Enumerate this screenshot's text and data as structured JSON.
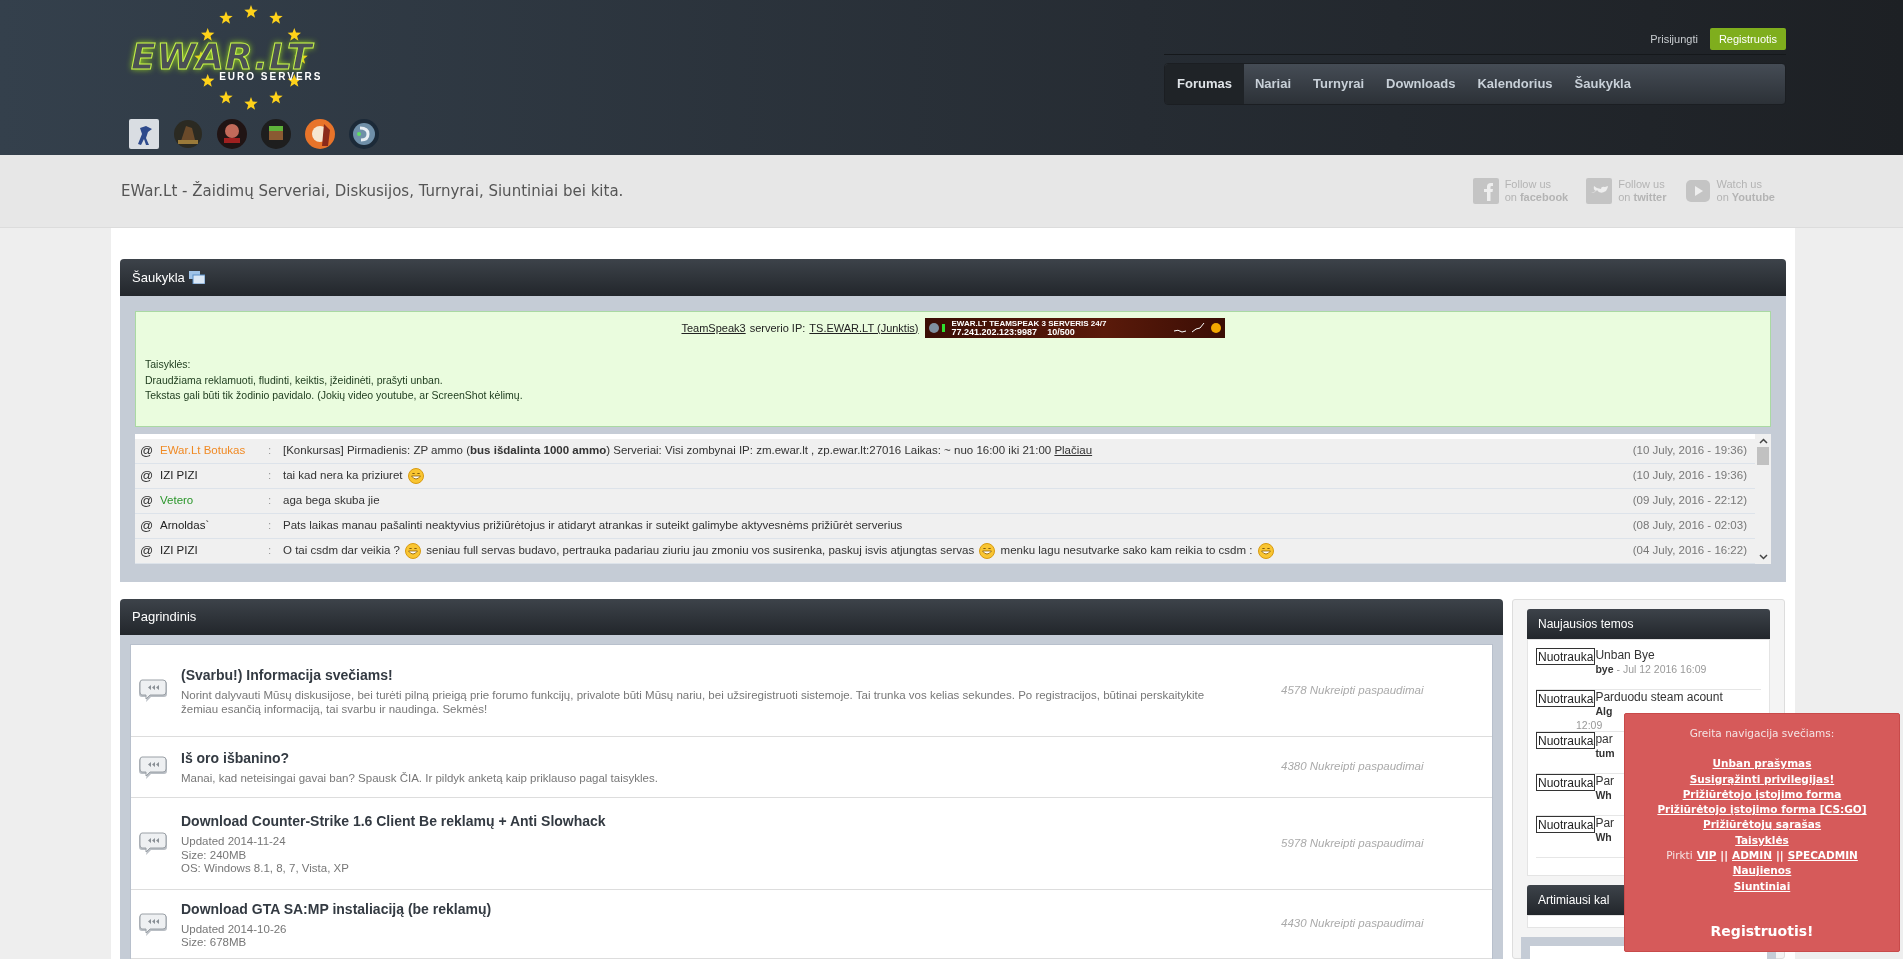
{
  "header": {
    "logo": {
      "title": "EWAR.LT",
      "subtitle": "EURO SERVERS"
    },
    "login_link": "Prisijungti",
    "register_button": "Registruotis",
    "nav": [
      {
        "label": "Forumas",
        "selected": true
      },
      {
        "label": "Nariai",
        "selected": false
      },
      {
        "label": "Turnyrai",
        "selected": false
      },
      {
        "label": "Downloads",
        "selected": false
      },
      {
        "label": "Kalendorius",
        "selected": false
      },
      {
        "label": "Šaukykla",
        "selected": false
      }
    ]
  },
  "tagline": "EWar.Lt - Žaidimų Serveriai, Diskusijos, Turnyrai, Siuntiniai bei kita.",
  "social": [
    {
      "kind": "facebook",
      "line1": "Follow us",
      "line2": "on **facebook**"
    },
    {
      "kind": "twitter",
      "line1": "Follow us",
      "line2": "on **twitter**"
    },
    {
      "kind": "youtube",
      "line1": "Watch us",
      "line2": "on **Youtube**"
    }
  ],
  "shoutbox": {
    "title": "Šaukykla",
    "notice": {
      "ts_link": "TeamSpeak3",
      "ts_text": "serverio IP:",
      "ip_link": "TS.EWAR.LT (Junktis)",
      "banner": {
        "line1": "EWAR.LT TEAMSPEAK 3 SERVERIS 24/7",
        "line2": "77.241.202.123:9987",
        "line3": "10/500"
      },
      "rules": [
        "Taisyklės:",
        "Draudžiama reklamuoti, fludinti, keiktis, įžeidinėti, prašyti unban.",
        "Tekstas gali būti tik žodinio pavidalo. (Jokių video youtube, ar ScreenShot kėlimų."
      ]
    },
    "mention_symbol": "@",
    "separator": ":",
    "messages": [
      {
        "author": "EWar.Lt Botukas",
        "color": "#f08a24",
        "parts": [
          {
            "kind": "text",
            "text": "[Konkursas] Pirmadienis: ZP ammo (**bus išdalinta 1000 ammo**) Serveriai: Visi zombynai IP: zm.ewar.lt , zp.ewar.lt:27016 Laikas: ~ nuo 16:00 iki 21:00"
          },
          {
            "kind": "link",
            "text": "Plačiau"
          }
        ],
        "time": "(10 July, 2016 - 19:36)"
      },
      {
        "author": "IZI PIZI",
        "color": "#222222",
        "parts": [
          {
            "kind": "text",
            "text": "tai kad nera ka priziuret"
          },
          {
            "kind": "smiley"
          }
        ],
        "time": "(10 July, 2016 - 19:36)"
      },
      {
        "author": "Vetero",
        "color": "#2a962a",
        "parts": [
          {
            "kind": "text",
            "text": "aga bega skuba jie"
          }
        ],
        "time": "(09 July, 2016 - 22:12)"
      },
      {
        "author": "Arnoldas`",
        "color": "#222222",
        "parts": [
          {
            "kind": "text",
            "text": "Pats laikas manau pašalinti neaktyvius prižiūrėtojus ir atidaryt atrankas ir suteikt galimybe aktyvesnėms prižiūrėt serverius"
          }
        ],
        "time": "(08 July, 2016 - 02:03)"
      },
      {
        "author": "IZI PIZI",
        "color": "#222222",
        "parts": [
          {
            "kind": "text",
            "text": "O tai csdm dar veikia ?"
          },
          {
            "kind": "smiley"
          },
          {
            "kind": "text",
            "text": "seniau full servas budavo, pertrauka padariau ziuriu jau zmoniu vos susirenka, paskuj isvis atjungtas servas"
          },
          {
            "kind": "smiley"
          },
          {
            "kind": "text",
            "text": "menku lagu nesutvarke sako kam reikia to csdm :"
          },
          {
            "kind": "smiley"
          }
        ],
        "time": "(04 July, 2016 - 16:22)"
      }
    ]
  },
  "forum": {
    "title": "Pagrindinis",
    "rows": [
      {
        "title": "(Svarbu!) Informacija svečiams!",
        "lines": [
          "Norint dalyvauti Mūsų diskusijose, bei turėti pilną prieigą prie forumo funkcijų, privalote būti Mūsų nariu, bei užsiregistruoti sistemoje. Tai trunka vos kelias sekundes. Po registracijos, būtinai perskaitykite žemiau esančią informaciją, tai svarbu ir naudinga. Sekmės!"
        ],
        "clicks": "4578 Nukreipti paspaudimai"
      },
      {
        "title": "Iš oro išbanino?",
        "lines": [
          "Manai, kad neteisingai gavai ban? Spausk ČIA. Ir pildyk anketą kaip priklauso pagal taisykles."
        ],
        "clicks": "4380 Nukreipti paspaudimai"
      },
      {
        "title": "Download Counter-Strike 1.6 Client Be reklamų + Anti Slowhack",
        "lines": [
          "Updated 2014-11-24",
          "Size: 240MB",
          "OS: Windows 8.1, 8, 7, Vista, XP"
        ],
        "clicks": "5978 Nukreipti paspaudimai"
      },
      {
        "title": "Download GTA SA:MP instaliaciją (be reklamų)",
        "lines": [
          "Updated 2014-10-26",
          "Size: 678MB"
        ],
        "clicks": "4430 Nukreipti paspaudimai"
      }
    ]
  },
  "sidebar": {
    "latest": {
      "title": "Naujausios temos",
      "items": [
        {
          "image_alt": "Nuotrauka",
          "title": "Unban Bye",
          "author": "bye",
          "date": "- Jul 12 2016 16:09"
        },
        {
          "image_alt": "Nuotrauka",
          "title": "Parduodu steam acount",
          "author": "Alg",
          "overflow": "12:09"
        },
        {
          "image_alt": "Nuotrauka",
          "title": "par",
          "author": "tum"
        },
        {
          "image_alt": "Nuotrauka",
          "title": "Par",
          "author": "Wh"
        },
        {
          "image_alt": "Nuotrauka",
          "title": "Par",
          "author": "Wh"
        }
      ]
    },
    "calendar": {
      "title": "Artimiausi kal"
    }
  },
  "guest_popup": {
    "title": "Greita navigacija svečiams:",
    "links_before": [
      "Unban prašymas",
      "Susigrąžinti privilegijas!",
      "Prižiūrėtojo įstojimo forma",
      "Prižiūrėtojo įstojimo forma [CS:GO]",
      "Prižiūrėtojų sąrašas",
      "Taisyklės"
    ],
    "buy": {
      "label": "Pirkti",
      "separator": "||",
      "links": [
        "VIP",
        "ADMIN",
        "SPECADMIN"
      ]
    },
    "links_after": [
      "Naujienos",
      "Siuntiniai"
    ],
    "register": "Registruotis!"
  }
}
